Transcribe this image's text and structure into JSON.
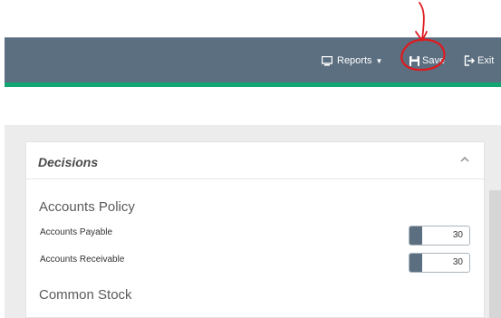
{
  "navbar": {
    "reports_label": "Reports",
    "reports_icon": "monitor-icon",
    "save_label": "Save",
    "save_icon": "floppy-disk-icon",
    "exit_label": "Exit",
    "exit_icon": "sign-out-icon",
    "bar_color": "#5c6f80",
    "accent_color": "#13a574"
  },
  "annotation": {
    "color": "#e0191e",
    "shape": "arrow-and-circle-around-save"
  },
  "panel": {
    "title": "Decisions",
    "collapse_icon": "chevron-up-icon",
    "sections": [
      {
        "title": "Accounts Policy",
        "fields": [
          {
            "label": "Accounts Payable",
            "value": "30"
          },
          {
            "label": "Accounts Receivable",
            "value": "30"
          }
        ]
      },
      {
        "title": "Common Stock",
        "fields": []
      }
    ]
  }
}
